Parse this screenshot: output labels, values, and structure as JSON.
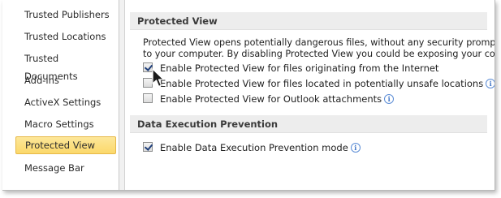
{
  "nav": {
    "items": [
      {
        "label": "Trusted Publishers"
      },
      {
        "label": "Trusted Locations"
      },
      {
        "label": "Trusted Documents"
      },
      {
        "label": "Add-ins"
      },
      {
        "label": "ActiveX Settings"
      },
      {
        "label": "Macro Settings"
      },
      {
        "label": "Protected View",
        "selected": true
      },
      {
        "label": "Message Bar"
      }
    ]
  },
  "protected_view": {
    "header": "Protected View",
    "desc_line1": "Protected View opens potentially dangerous files, without any security prompts, i",
    "desc_line2": "to your computer. By disabling Protected View you could be exposing your compu",
    "options": [
      {
        "label": "Enable Protected View for files originating from the Internet",
        "checked": true,
        "info": false
      },
      {
        "label": "Enable Protected View for files located in potentially unsafe locations",
        "checked": false,
        "info": true
      },
      {
        "label": "Enable Protected View for Outlook attachments",
        "checked": false,
        "info": true
      }
    ]
  },
  "dep": {
    "header": "Data Execution Prevention",
    "option": {
      "label": "Enable Data Execution Prevention mode",
      "checked": true,
      "info": true
    }
  },
  "icons": {
    "info": "info-icon",
    "cursor": "mouse-pointer-icon"
  }
}
